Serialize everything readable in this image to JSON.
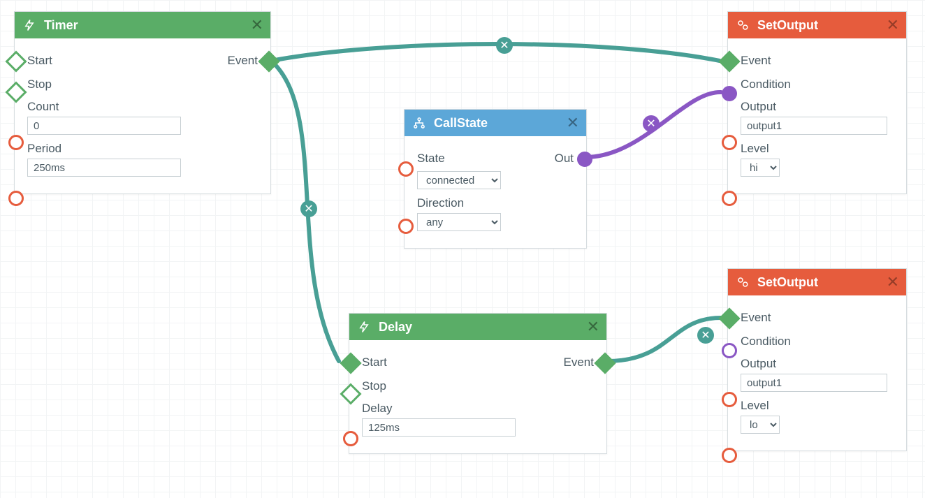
{
  "chart_data": {
    "type": "node_graph",
    "nodes": [
      {
        "id": "timer",
        "type": "Timer",
        "color": "green",
        "inputs": [
          "Start",
          "Stop"
        ],
        "outputs": [
          "Event"
        ],
        "params": {
          "Count": "0",
          "Period": "250ms"
        }
      },
      {
        "id": "callstate",
        "type": "CallState",
        "color": "blue",
        "inputs": [
          "State",
          "Direction"
        ],
        "outputs": [
          "Out"
        ],
        "params": {
          "State": "connected",
          "Direction": "any"
        }
      },
      {
        "id": "delay",
        "type": "Delay",
        "color": "green",
        "inputs": [
          "Start",
          "Stop"
        ],
        "outputs": [
          "Event"
        ],
        "params": {
          "Delay": "125ms"
        }
      },
      {
        "id": "setoutput1",
        "type": "SetOutput",
        "color": "red",
        "inputs": [
          "Event",
          "Condition",
          "Output",
          "Level"
        ],
        "outputs": [],
        "params": {
          "Output": "output1",
          "Level": "hi"
        }
      },
      {
        "id": "setoutput2",
        "type": "SetOutput",
        "color": "red",
        "inputs": [
          "Event",
          "Condition",
          "Output",
          "Level"
        ],
        "outputs": [],
        "params": {
          "Output": "output1",
          "Level": "lo"
        }
      }
    ],
    "edges": [
      {
        "from": "timer.Event",
        "to": "setoutput1.Event",
        "color": "teal"
      },
      {
        "from": "timer.Event",
        "to": "delay.Start",
        "color": "teal"
      },
      {
        "from": "callstate.Out",
        "to": "setoutput1.Condition",
        "color": "purple"
      },
      {
        "from": "delay.Event",
        "to": "setoutput2.Event",
        "color": "teal"
      }
    ]
  },
  "nodes": {
    "timer": {
      "title": "Timer",
      "ports": {
        "start": "Start",
        "stop": "Stop",
        "event": "Event"
      },
      "fields": {
        "count_label": "Count",
        "count_value": "0",
        "period_label": "Period",
        "period_value": "250ms"
      }
    },
    "callstate": {
      "title": "CallState",
      "ports": {
        "out": "Out"
      },
      "fields": {
        "state_label": "State",
        "state_value": "connected",
        "state_options": [
          "connected"
        ],
        "direction_label": "Direction",
        "direction_value": "any",
        "direction_options": [
          "any"
        ]
      }
    },
    "delay": {
      "title": "Delay",
      "ports": {
        "start": "Start",
        "stop": "Stop",
        "event": "Event"
      },
      "fields": {
        "delay_label": "Delay",
        "delay_value": "125ms"
      }
    },
    "setoutput1": {
      "title": "SetOutput",
      "ports": {
        "event": "Event",
        "condition": "Condition"
      },
      "fields": {
        "output_label": "Output",
        "output_value": "output1",
        "level_label": "Level",
        "level_value": "hi",
        "level_options": [
          "hi"
        ]
      }
    },
    "setoutput2": {
      "title": "SetOutput",
      "ports": {
        "event": "Event",
        "condition": "Condition"
      },
      "fields": {
        "output_label": "Output",
        "output_value": "output1",
        "level_label": "Level",
        "level_value": "lo",
        "level_options": [
          "lo"
        ]
      }
    }
  },
  "colors": {
    "teal": "#489f95",
    "purple": "#8a57c4"
  }
}
